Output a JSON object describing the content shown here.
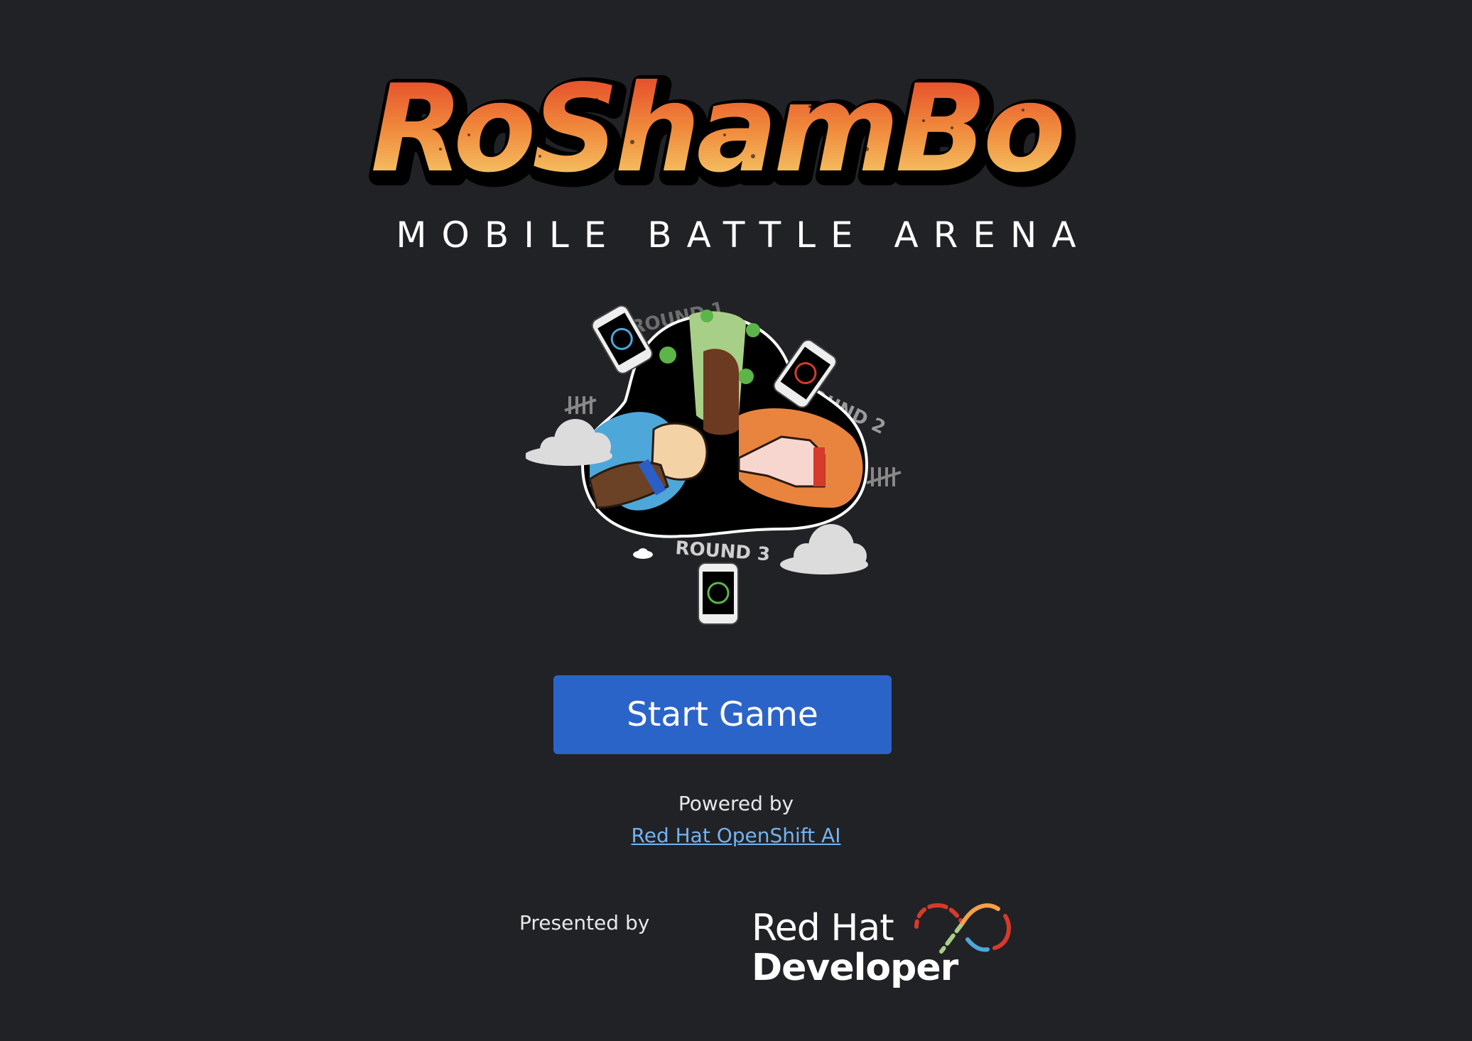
{
  "app": {
    "logo_text": "RoShamBo",
    "subtitle": "MOBILE BATTLE ARENA"
  },
  "illustration": {
    "round_labels": [
      "ROUND 1",
      "ROUND 2",
      "ROUND 3"
    ]
  },
  "actions": {
    "start_label": "Start Game"
  },
  "footer": {
    "powered_by": "Powered by",
    "powered_link": "Red Hat OpenShift AI",
    "presented_by": "Presented by",
    "brand_line1": "Red Hat",
    "brand_line2": "Developer"
  },
  "colors": {
    "background": "#212226",
    "button": "#2b64c9",
    "link": "#73b3f0",
    "logo_top": "#e8452a",
    "logo_bottom": "#f7d26a"
  }
}
